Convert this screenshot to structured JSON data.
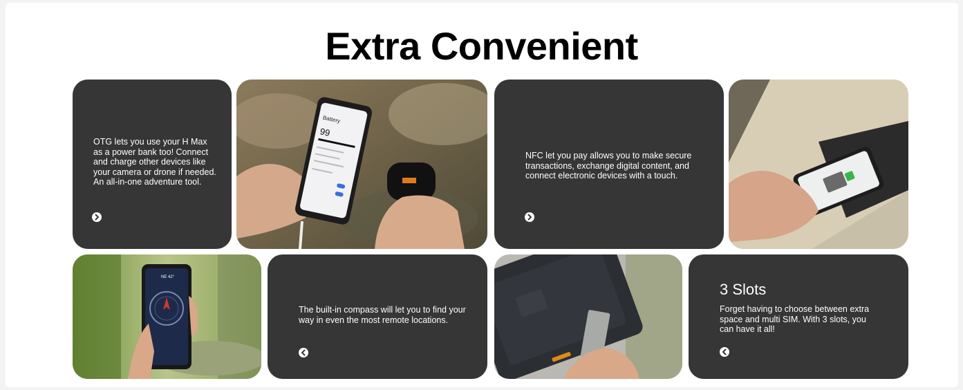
{
  "title": "Extra Convenient",
  "cards": {
    "otg": {
      "text": "OTG lets you use your H Max\nas a power bank too! Connect\nand charge other devices like\nyour camera or drone if needed.\nAn all-in-one adventure tool.",
      "arrow": "arrow-right-icon"
    },
    "nfc": {
      "text": "NFC let you pay allows you to make secure\ntransactions, exchange digital content, and\nconnect electronic devices with a touch.",
      "arrow": "arrow-right-icon"
    },
    "compass": {
      "text": "The built-in compass will let you to find your\nway in even the most remote locations.",
      "arrow": "arrow-left-icon"
    },
    "slots": {
      "heading": "3 Slots",
      "text": "Forget having to choose between extra\nspace and multi SIM. With 3 slots, you\ncan have it all!",
      "arrow": "arrow-left-icon"
    }
  },
  "phone_battery": {
    "title": "Battery",
    "level": "99"
  },
  "compass_screen": {
    "heading": "NE 42°"
  }
}
